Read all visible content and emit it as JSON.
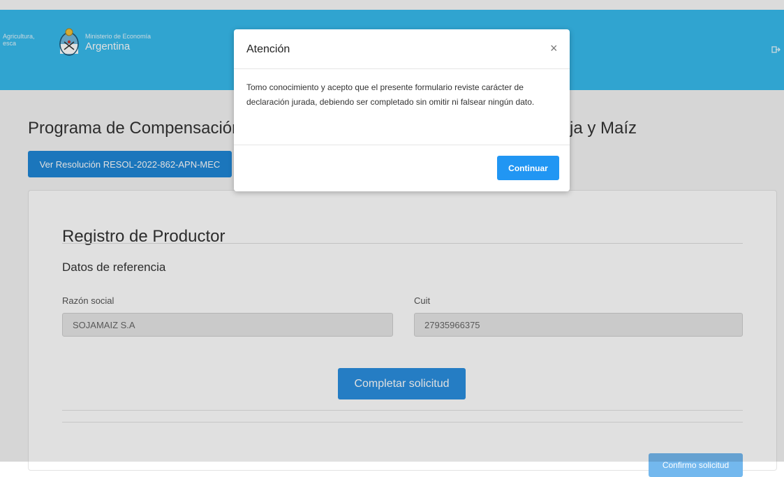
{
  "header": {
    "agency_partial_line1": "Agricultura,",
    "agency_partial_line2": "esca",
    "ministry_small": "Ministerio de Economía",
    "ministry_main": "Argentina",
    "colors": {
      "header_bg": "#37bbed"
    },
    "logout_icon": "logout-icon"
  },
  "page": {
    "title_left": "Programa de Compensación",
    "title_right": "ja y Maíz",
    "resolution_button": "Ver Resolución RESOL-2022-862-APN-MEC"
  },
  "form": {
    "title": "Registro de Productor",
    "subtitle": "Datos de referencia",
    "fields": [
      {
        "label": "Razón social",
        "value": "SOJAMAIZ S.A"
      },
      {
        "label": "Cuit",
        "value": "27935966375"
      }
    ],
    "complete_button": "Completar solicitud",
    "confirm_button": "Confirmo solicitud"
  },
  "modal": {
    "title": "Atención",
    "close_symbol": "×",
    "body": "Tomo conocimiento y acepto que el presente formulario reviste carácter de declaración jurada, debiendo ser completado sin omitir ni falsear ningún dato.",
    "continue_button": "Continuar"
  }
}
